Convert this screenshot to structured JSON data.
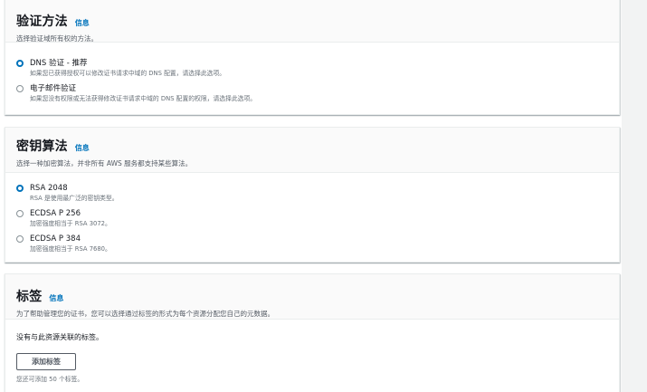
{
  "validation": {
    "title": "验证方法",
    "info": "信息",
    "description": "选择验证域所有权的方法。",
    "options": [
      {
        "label": "DNS 验证 - 推荐",
        "description": "如果您已获得授权可以修改证书请求中域的 DNS 配置，请选择此选项。",
        "selected": true
      },
      {
        "label": "电子邮件验证",
        "description": "如果您没有权限或无法获得修改证书请求中域的 DNS 配置的权限，请选择此选项。",
        "selected": false
      }
    ]
  },
  "algorithm": {
    "title": "密钥算法",
    "info": "信息",
    "description": "选择一种加密算法，并非所有 AWS 服务都支持某些算法。",
    "options": [
      {
        "label": "RSA 2048",
        "description": "RSA 是使用最广泛的密钥类型。",
        "selected": true
      },
      {
        "label": "ECDSA P 256",
        "description": "加密强度相当于 RSA 3072。",
        "selected": false
      },
      {
        "label": "ECDSA P 384",
        "description": "加密强度相当于 RSA 7680。",
        "selected": false
      }
    ]
  },
  "tags": {
    "title": "标签",
    "info": "信息",
    "description": "为了帮助管理您的证书，您可以选择通过标签的形式为每个资源分配您自己的元数据。",
    "empty_text": "没有与此资源关联的标签。",
    "add_button": "添加标签",
    "hint": "您还可添加 50 个标签。"
  }
}
